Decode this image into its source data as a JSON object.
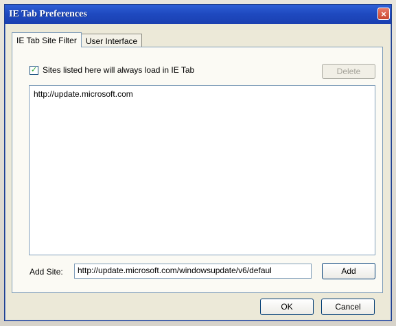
{
  "window": {
    "title": "IE Tab Preferences",
    "close_glyph": "×"
  },
  "tabs": [
    {
      "label": "IE Tab Site Filter",
      "active": true
    },
    {
      "label": "User Interface",
      "active": false
    }
  ],
  "site_filter": {
    "checkbox_label": "Sites listed here will always load in IE Tab",
    "checkbox_checked": true,
    "checkbox_glyph": "✓",
    "delete_label": "Delete",
    "sites": [
      "http://update.microsoft.com"
    ],
    "add_site_label": "Add Site:",
    "add_site_value": "http://update.microsoft.com/windowsupdate/v6/defaul",
    "add_label": "Add"
  },
  "footer": {
    "ok_label": "OK",
    "cancel_label": "Cancel"
  },
  "colors": {
    "titlebar": "#1f4ac0",
    "close": "#c8452f",
    "window_bg": "#ece9d8",
    "panel_border": "#7f9db9"
  },
  "icons": {
    "close": "close-icon",
    "check": "check-icon"
  }
}
